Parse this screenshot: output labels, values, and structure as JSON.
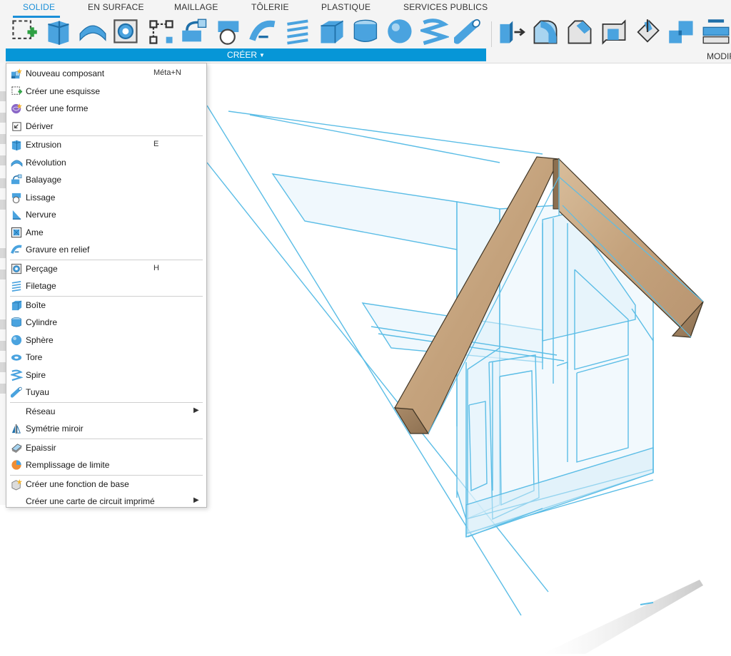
{
  "tabs": [
    {
      "label": "SOLIDE",
      "active": true
    },
    {
      "label": "EN SURFACE",
      "active": false
    },
    {
      "label": "MAILLAGE",
      "active": false
    },
    {
      "label": "TÔLERIE",
      "active": false
    },
    {
      "label": "PLASTIQUE",
      "active": false
    },
    {
      "label": "SERVICES PUBLICS",
      "active": false
    }
  ],
  "toolbar": {
    "create_label": "CRÉER",
    "modify_label": "MODIF",
    "create_tools": [
      "sketch-icon",
      "extrude-icon",
      "revolve-icon",
      "hole-icon",
      "dimension-icon",
      "sweep-icon",
      "loft-icon",
      "emboss-icon",
      "thread-icon",
      "box-icon",
      "cylinder-icon",
      "sphere-icon",
      "coil-icon",
      "pipe-icon"
    ],
    "modify_tools": [
      "press-pull-icon",
      "fillet-icon",
      "chamfer-icon",
      "shell-icon",
      "draft-icon",
      "scale-icon",
      "combine-icon"
    ]
  },
  "menu": {
    "groups": [
      [
        {
          "label": "Nouveau composant",
          "shortcut": "Méta+N",
          "icon": "new-component-icon"
        },
        {
          "label": "Créer une esquisse",
          "icon": "sketch-icon"
        },
        {
          "label": "Créer une forme",
          "icon": "form-icon"
        },
        {
          "label": "Dériver",
          "icon": "derive-icon"
        }
      ],
      [
        {
          "label": "Extrusion",
          "shortcut": "E",
          "icon": "extrude-icon"
        },
        {
          "label": "Révolution",
          "icon": "revolve-icon"
        },
        {
          "label": "Balayage",
          "icon": "sweep-icon"
        },
        {
          "label": "Lissage",
          "icon": "loft-icon"
        },
        {
          "label": "Nervure",
          "icon": "rib-icon"
        },
        {
          "label": "Ame",
          "icon": "web-icon"
        },
        {
          "label": "Gravure en relief",
          "icon": "emboss-icon"
        }
      ],
      [
        {
          "label": "Perçage",
          "shortcut": "H",
          "icon": "hole-icon"
        },
        {
          "label": "Filetage",
          "icon": "thread-icon"
        }
      ],
      [
        {
          "label": "Boîte",
          "icon": "box-icon"
        },
        {
          "label": "Cylindre",
          "icon": "cylinder-icon"
        },
        {
          "label": "Sphère",
          "icon": "sphere-icon"
        },
        {
          "label": "Tore",
          "icon": "torus-icon"
        },
        {
          "label": "Spire",
          "icon": "coil-icon"
        },
        {
          "label": "Tuyau",
          "icon": "pipe-icon"
        }
      ],
      [
        {
          "label": "Réseau",
          "submenu": true,
          "icon": ""
        },
        {
          "label": "Symétrie miroir",
          "icon": "mirror-icon"
        }
      ],
      [
        {
          "label": "Epaissir",
          "icon": "thicken-icon"
        },
        {
          "label": "Remplissage de limite",
          "icon": "boundary-fill-icon"
        }
      ],
      [
        {
          "label": "Créer une fonction de base",
          "icon": "base-feature-icon"
        },
        {
          "label": "Créer une carte de circuit imprimé",
          "submenu": true,
          "icon": ""
        }
      ]
    ]
  },
  "colors": {
    "accent": "#0696d7",
    "tab_active": "#1a8fd8",
    "icon_blue": "#4aa3df",
    "wire": "#5bbde6",
    "wood": "#c7a684"
  }
}
